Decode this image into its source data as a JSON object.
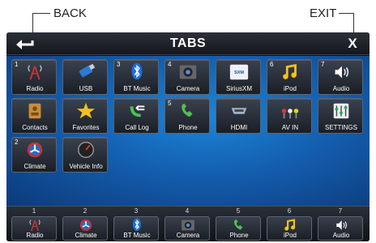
{
  "callouts": {
    "back": "BACK",
    "exit": "EXIT"
  },
  "header": {
    "title": "TABS",
    "exit_label": "X"
  },
  "tabs": [
    {
      "num": "1",
      "label": "Radio",
      "icon": "radio-tower-icon"
    },
    {
      "num": "",
      "label": "USB",
      "icon": "usb-icon"
    },
    {
      "num": "3",
      "label": "BT Music",
      "icon": "bluetooth-icon"
    },
    {
      "num": "4",
      "label": "Camera",
      "icon": "camera-icon"
    },
    {
      "num": "",
      "label": "SiriusXM",
      "icon": "siriusxm-icon"
    },
    {
      "num": "6",
      "label": "iPod",
      "icon": "music-note-icon"
    },
    {
      "num": "7",
      "label": "Audio",
      "icon": "speaker-icon"
    },
    {
      "num": "",
      "label": "Contacts",
      "icon": "contacts-book-icon"
    },
    {
      "num": "",
      "label": "Favorites",
      "icon": "star-icon"
    },
    {
      "num": "",
      "label": "Call Log",
      "icon": "call-log-icon"
    },
    {
      "num": "5",
      "label": "Phone",
      "icon": "phone-icon"
    },
    {
      "num": "",
      "label": "HDMI",
      "icon": "hdmi-icon"
    },
    {
      "num": "",
      "label": "AV IN",
      "icon": "av-cable-icon"
    },
    {
      "num": "",
      "label": "SETTINGS",
      "icon": "settings-sliders-icon"
    },
    {
      "num": "2",
      "label": "Climate",
      "icon": "climate-fan-icon"
    },
    {
      "num": "",
      "label": "Vehicle Info",
      "icon": "gauge-icon"
    }
  ],
  "shortcuts": [
    {
      "num": "1",
      "label": "Radio",
      "icon": "radio-tower-icon"
    },
    {
      "num": "2",
      "label": "Climate",
      "icon": "climate-fan-icon"
    },
    {
      "num": "3",
      "label": "BT Music",
      "icon": "bluetooth-icon"
    },
    {
      "num": "4",
      "label": "Camera",
      "icon": "camera-icon"
    },
    {
      "num": "5",
      "label": "Phone",
      "icon": "phone-icon"
    },
    {
      "num": "6",
      "label": "iPod",
      "icon": "music-note-icon"
    },
    {
      "num": "7",
      "label": "Audio",
      "icon": "speaker-icon"
    }
  ],
  "colors": {
    "accent_blue": "#1c86d9",
    "tile_dark": "#1a1e25"
  }
}
